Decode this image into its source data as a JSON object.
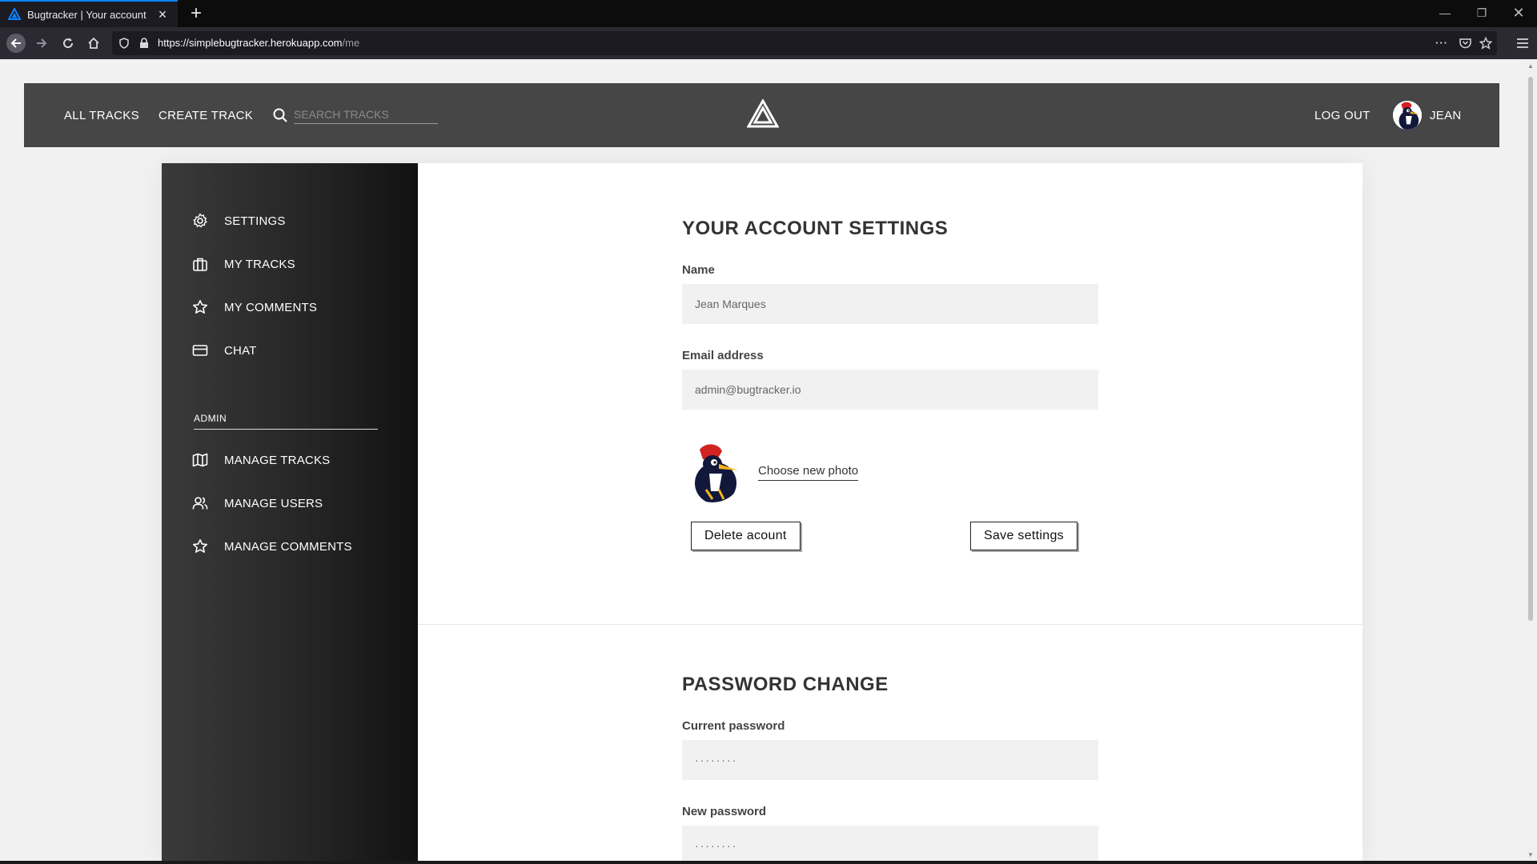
{
  "browser": {
    "tab_title": "Bugtracker | Your account",
    "url_host": "https://simplebugtracker.herokuapp.com",
    "url_path": "/me",
    "ellipsis": "···"
  },
  "header": {
    "nav": [
      "ALL TRACKS",
      "CREATE TRACK"
    ],
    "search_placeholder": "SEARCH TRACKS",
    "logout": "LOG OUT",
    "username": "JEAN"
  },
  "sidebar": {
    "items": [
      {
        "label": "SETTINGS",
        "icon": "gear-icon"
      },
      {
        "label": "MY TRACKS",
        "icon": "briefcase-icon"
      },
      {
        "label": "MY COMMENTS",
        "icon": "star-icon"
      },
      {
        "label": "CHAT",
        "icon": "credit-card-icon"
      }
    ],
    "admin_heading": "ADMIN",
    "admin_items": [
      {
        "label": "MANAGE TRACKS",
        "icon": "map-icon"
      },
      {
        "label": "MANAGE USERS",
        "icon": "users-icon"
      },
      {
        "label": "MANAGE COMMENTS",
        "icon": "star-icon"
      }
    ]
  },
  "account": {
    "title": "YOUR ACCOUNT SETTINGS",
    "name_label": "Name",
    "name_value": "Jean Marques",
    "email_label": "Email address",
    "email_value": "admin@bugtracker.io",
    "choose_photo": "Choose new photo",
    "delete_button": "Delete acount",
    "save_button": "Save settings"
  },
  "password": {
    "title": "PASSWORD CHANGE",
    "current_label": "Current password",
    "current_value": "········",
    "new_label": "New password",
    "new_value": "········"
  }
}
